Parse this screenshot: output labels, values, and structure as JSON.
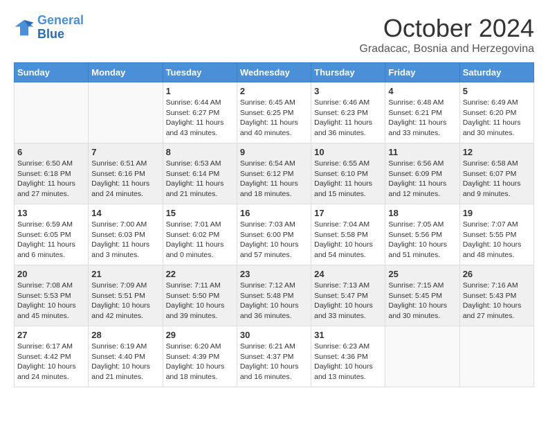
{
  "header": {
    "logo_line1": "General",
    "logo_line2": "Blue",
    "month": "October 2024",
    "location": "Gradacac, Bosnia and Herzegovina"
  },
  "days_of_week": [
    "Sunday",
    "Monday",
    "Tuesday",
    "Wednesday",
    "Thursday",
    "Friday",
    "Saturday"
  ],
  "weeks": [
    [
      {
        "day": "",
        "info": ""
      },
      {
        "day": "",
        "info": ""
      },
      {
        "day": "1",
        "info": "Sunrise: 6:44 AM\nSunset: 6:27 PM\nDaylight: 11 hours and 43 minutes."
      },
      {
        "day": "2",
        "info": "Sunrise: 6:45 AM\nSunset: 6:25 PM\nDaylight: 11 hours and 40 minutes."
      },
      {
        "day": "3",
        "info": "Sunrise: 6:46 AM\nSunset: 6:23 PM\nDaylight: 11 hours and 36 minutes."
      },
      {
        "day": "4",
        "info": "Sunrise: 6:48 AM\nSunset: 6:21 PM\nDaylight: 11 hours and 33 minutes."
      },
      {
        "day": "5",
        "info": "Sunrise: 6:49 AM\nSunset: 6:20 PM\nDaylight: 11 hours and 30 minutes."
      }
    ],
    [
      {
        "day": "6",
        "info": "Sunrise: 6:50 AM\nSunset: 6:18 PM\nDaylight: 11 hours and 27 minutes."
      },
      {
        "day": "7",
        "info": "Sunrise: 6:51 AM\nSunset: 6:16 PM\nDaylight: 11 hours and 24 minutes."
      },
      {
        "day": "8",
        "info": "Sunrise: 6:53 AM\nSunset: 6:14 PM\nDaylight: 11 hours and 21 minutes."
      },
      {
        "day": "9",
        "info": "Sunrise: 6:54 AM\nSunset: 6:12 PM\nDaylight: 11 hours and 18 minutes."
      },
      {
        "day": "10",
        "info": "Sunrise: 6:55 AM\nSunset: 6:10 PM\nDaylight: 11 hours and 15 minutes."
      },
      {
        "day": "11",
        "info": "Sunrise: 6:56 AM\nSunset: 6:09 PM\nDaylight: 11 hours and 12 minutes."
      },
      {
        "day": "12",
        "info": "Sunrise: 6:58 AM\nSunset: 6:07 PM\nDaylight: 11 hours and 9 minutes."
      }
    ],
    [
      {
        "day": "13",
        "info": "Sunrise: 6:59 AM\nSunset: 6:05 PM\nDaylight: 11 hours and 6 minutes."
      },
      {
        "day": "14",
        "info": "Sunrise: 7:00 AM\nSunset: 6:03 PM\nDaylight: 11 hours and 3 minutes."
      },
      {
        "day": "15",
        "info": "Sunrise: 7:01 AM\nSunset: 6:02 PM\nDaylight: 11 hours and 0 minutes."
      },
      {
        "day": "16",
        "info": "Sunrise: 7:03 AM\nSunset: 6:00 PM\nDaylight: 10 hours and 57 minutes."
      },
      {
        "day": "17",
        "info": "Sunrise: 7:04 AM\nSunset: 5:58 PM\nDaylight: 10 hours and 54 minutes."
      },
      {
        "day": "18",
        "info": "Sunrise: 7:05 AM\nSunset: 5:56 PM\nDaylight: 10 hours and 51 minutes."
      },
      {
        "day": "19",
        "info": "Sunrise: 7:07 AM\nSunset: 5:55 PM\nDaylight: 10 hours and 48 minutes."
      }
    ],
    [
      {
        "day": "20",
        "info": "Sunrise: 7:08 AM\nSunset: 5:53 PM\nDaylight: 10 hours and 45 minutes."
      },
      {
        "day": "21",
        "info": "Sunrise: 7:09 AM\nSunset: 5:51 PM\nDaylight: 10 hours and 42 minutes."
      },
      {
        "day": "22",
        "info": "Sunrise: 7:11 AM\nSunset: 5:50 PM\nDaylight: 10 hours and 39 minutes."
      },
      {
        "day": "23",
        "info": "Sunrise: 7:12 AM\nSunset: 5:48 PM\nDaylight: 10 hours and 36 minutes."
      },
      {
        "day": "24",
        "info": "Sunrise: 7:13 AM\nSunset: 5:47 PM\nDaylight: 10 hours and 33 minutes."
      },
      {
        "day": "25",
        "info": "Sunrise: 7:15 AM\nSunset: 5:45 PM\nDaylight: 10 hours and 30 minutes."
      },
      {
        "day": "26",
        "info": "Sunrise: 7:16 AM\nSunset: 5:43 PM\nDaylight: 10 hours and 27 minutes."
      }
    ],
    [
      {
        "day": "27",
        "info": "Sunrise: 6:17 AM\nSunset: 4:42 PM\nDaylight: 10 hours and 24 minutes."
      },
      {
        "day": "28",
        "info": "Sunrise: 6:19 AM\nSunset: 4:40 PM\nDaylight: 10 hours and 21 minutes."
      },
      {
        "day": "29",
        "info": "Sunrise: 6:20 AM\nSunset: 4:39 PM\nDaylight: 10 hours and 18 minutes."
      },
      {
        "day": "30",
        "info": "Sunrise: 6:21 AM\nSunset: 4:37 PM\nDaylight: 10 hours and 16 minutes."
      },
      {
        "day": "31",
        "info": "Sunrise: 6:23 AM\nSunset: 4:36 PM\nDaylight: 10 hours and 13 minutes."
      },
      {
        "day": "",
        "info": ""
      },
      {
        "day": "",
        "info": ""
      }
    ]
  ]
}
